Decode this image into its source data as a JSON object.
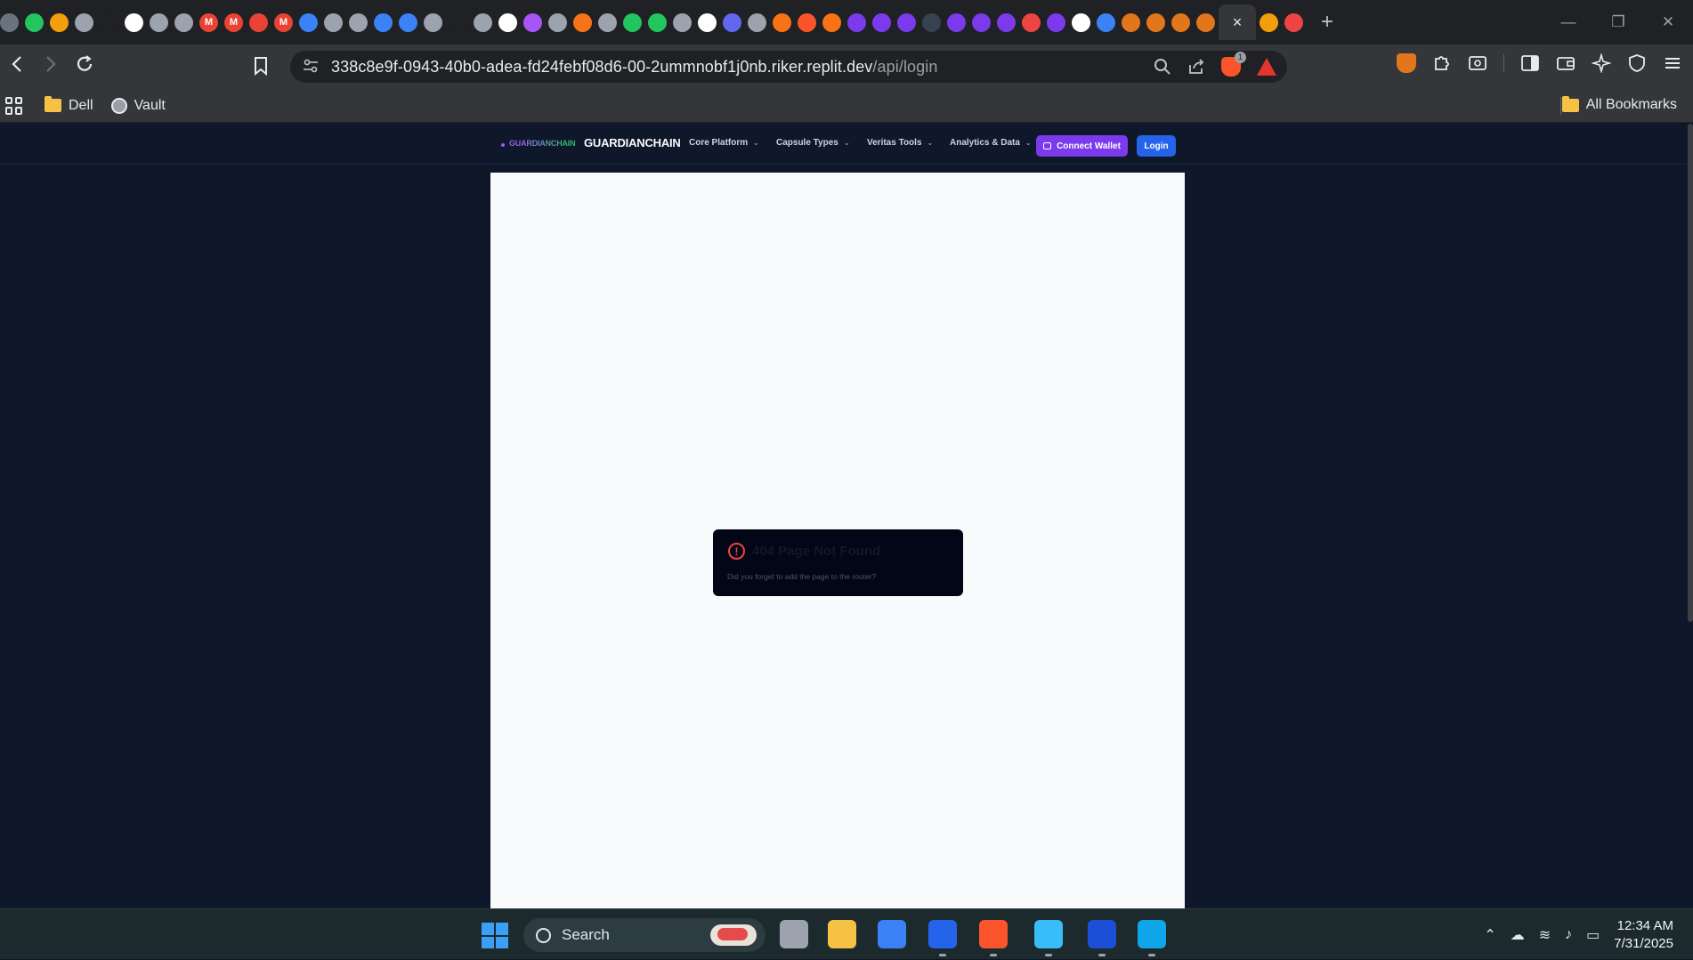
{
  "browser": {
    "tabs_count_note_hidden": "",
    "active_tab_close": "×",
    "new_tab": "+",
    "window_controls": {
      "minimize": "—",
      "restore": "❐",
      "close": "✕"
    },
    "url": {
      "host": "338c8e9f-0943-40b0-adea-fd24febf08d6-00-2ummnobf1j0nb.riker.replit.dev",
      "path": "/api/login"
    },
    "brave_shield_badge": "1",
    "bookmarks": [
      {
        "label": "Dell",
        "icon": "folder-icon"
      },
      {
        "label": "Vault",
        "icon": "globe-icon"
      }
    ],
    "all_bookmarks": "All Bookmarks",
    "tab_favicons": [
      {
        "c": "#6b7280",
        "t": ""
      },
      {
        "c": "#22c55e",
        "t": ""
      },
      {
        "c": "#f59e0b",
        "t": ""
      },
      {
        "c": "#9ca3af",
        "t": ""
      },
      {
        "c": "#202124",
        "t": ""
      },
      {
        "c": "#ffffff",
        "t": ""
      },
      {
        "c": "#9ca3af",
        "t": ""
      },
      {
        "c": "#9ca3af",
        "t": ""
      },
      {
        "c": "#ea4335",
        "t": "M"
      },
      {
        "c": "#ea4335",
        "t": "M"
      },
      {
        "c": "#ea4335",
        "t": ""
      },
      {
        "c": "#ea4335",
        "t": "M"
      },
      {
        "c": "#3b82f6",
        "t": ""
      },
      {
        "c": "#9ca3af",
        "t": ""
      },
      {
        "c": "#9ca3af",
        "t": ""
      },
      {
        "c": "#3b82f6",
        "t": ""
      },
      {
        "c": "#3b82f6",
        "t": ""
      },
      {
        "c": "#9ca3af",
        "t": ""
      },
      {
        "c": "#202124",
        "t": ""
      },
      {
        "c": "#9ca3af",
        "t": ""
      },
      {
        "c": "#ffffff",
        "t": ""
      },
      {
        "c": "#a855f7",
        "t": ""
      },
      {
        "c": "#9ca3af",
        "t": ""
      },
      {
        "c": "#f97316",
        "t": ""
      },
      {
        "c": "#9ca3af",
        "t": ""
      },
      {
        "c": "#22c55e",
        "t": ""
      },
      {
        "c": "#22c55e",
        "t": ""
      },
      {
        "c": "#9ca3af",
        "t": ""
      },
      {
        "c": "#ffffff",
        "t": ""
      },
      {
        "c": "#6366f1",
        "t": ""
      },
      {
        "c": "#9ca3af",
        "t": ""
      },
      {
        "c": "#f97316",
        "t": ""
      },
      {
        "c": "#fb542b",
        "t": ""
      },
      {
        "c": "#f97316",
        "t": ""
      },
      {
        "c": "#7c3aed",
        "t": ""
      },
      {
        "c": "#7c3aed",
        "t": ""
      },
      {
        "c": "#7c3aed",
        "t": ""
      },
      {
        "c": "#374151",
        "t": ""
      },
      {
        "c": "#7c3aed",
        "t": ""
      },
      {
        "c": "#7c3aed",
        "t": ""
      },
      {
        "c": "#7c3aed",
        "t": ""
      },
      {
        "c": "#ef4444",
        "t": ""
      },
      {
        "c": "#7c3aed",
        "t": ""
      },
      {
        "c": "#ffffff",
        "t": ""
      },
      {
        "c": "#3b82f6",
        "t": ""
      },
      {
        "c": "#e2761b",
        "t": ""
      },
      {
        "c": "#e2761b",
        "t": ""
      },
      {
        "c": "#e2761b",
        "t": ""
      },
      {
        "c": "#e2761b",
        "t": ""
      },
      {
        "c": "#f59e0b",
        "t": ""
      },
      {
        "c": "#ef4444",
        "t": ""
      }
    ]
  },
  "app": {
    "brand_small": "GUARDIANCHAIN",
    "brand_big": "GUARDIANCHAIN",
    "menus": [
      {
        "label": "Core Platform"
      },
      {
        "label": "Capsule Types"
      },
      {
        "label": "Veritas Tools"
      },
      {
        "label": "Analytics & Data"
      }
    ],
    "connect_wallet": "Connect Wallet",
    "login": "Login",
    "error": {
      "title": "404 Page Not Found",
      "description": "Did you forget to add the page to the router?"
    }
  },
  "taskbar": {
    "search_label": "Search",
    "time": "12:34 AM",
    "date": "7/31/2025"
  },
  "colors": {
    "page_bg": "#0f172a",
    "accent_purple": "#7c3aed",
    "accent_blue": "#2563eb",
    "error_red": "#ef4444"
  }
}
